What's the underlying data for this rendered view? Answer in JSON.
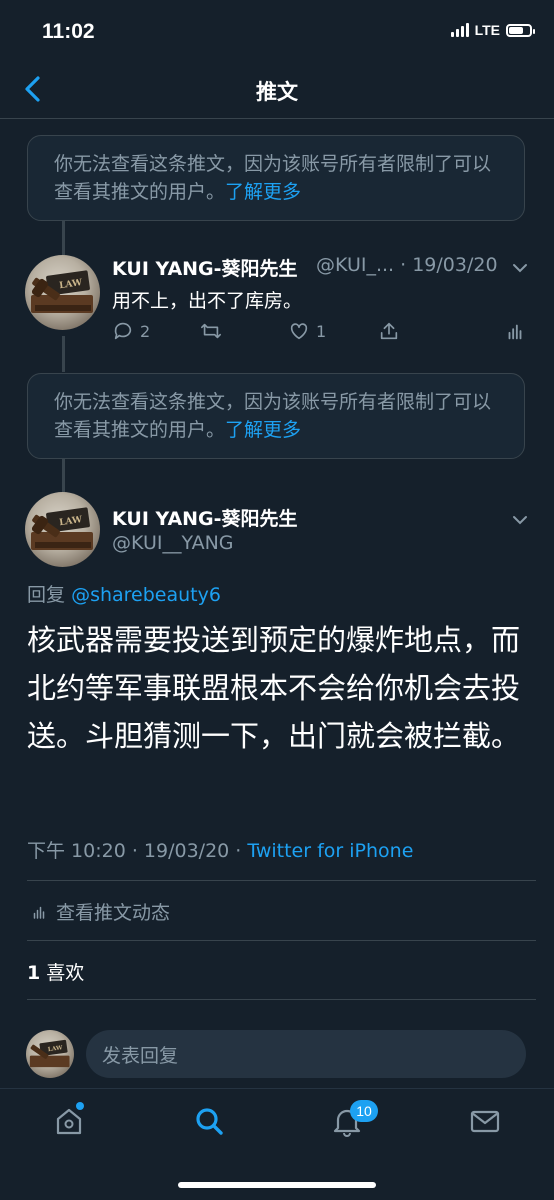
{
  "status_bar": {
    "time": "11:02",
    "network": "LTE"
  },
  "nav": {
    "title": "推文",
    "back_icon": "chevron-left-icon"
  },
  "restricted_notice": {
    "text": "你无法查看这条推文，因为该账号所有者限制了可以查看其推文的用户。",
    "link": "了解更多"
  },
  "reply_tweet": {
    "display_name": "KUI YANG-葵阳先生",
    "handle_and_date": "@KUI_... · 19/03/20",
    "text": "用不上，出不了库房。",
    "actions": {
      "reply_count": "2",
      "retweet_count": "",
      "like_count": "1"
    }
  },
  "main_tweet": {
    "display_name": "KUI YANG-葵阳先生",
    "handle": "@KUI__YANG",
    "reply_prefix": "回复",
    "reply_to": "@sharebeauty6",
    "text": "核武器需要投送到预定的爆炸地点，而北约等军事联盟根本不会给你机会去投送。斗胆猜测一下，出门就会被拦截。",
    "time": "下午 10:20 · 19/03/20 · ",
    "source": "Twitter for iPhone",
    "activity_label": "查看推文动态",
    "like_count": "1",
    "like_label": "喜欢"
  },
  "composer": {
    "placeholder": "发表回复"
  },
  "tab_bar": {
    "notification_badge": "10",
    "icons": [
      "home-icon",
      "search-icon",
      "bell-icon",
      "mail-icon"
    ]
  },
  "colors": {
    "background": "#15202b",
    "accent": "#1da1f2",
    "secondary_text": "#8899a6",
    "border": "#38444d"
  }
}
